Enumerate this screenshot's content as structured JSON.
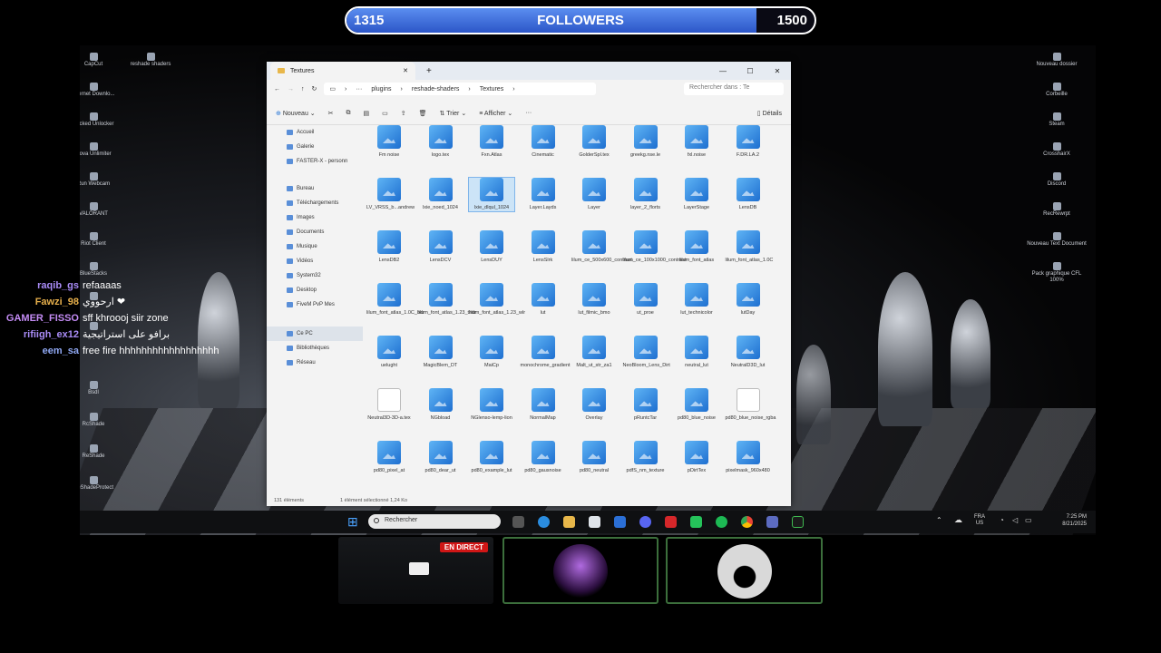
{
  "followers": {
    "current": "1315",
    "label": "FOLLOWERS",
    "goal": "1500",
    "progress": 0.8767
  },
  "desktop_icons": {
    "left": [
      "CapCut",
      "Internet Downlo...",
      "Clicked Unlocker",
      "Rova Unlimiter",
      "Run Webcam",
      "VALORANT",
      "Riot Client",
      "BlueStacks",
      "",
      ""
    ],
    "left_lower": [
      "Bsdl",
      "RcShade",
      "ReShade",
      "ReShadeProtect"
    ],
    "top": [
      "reshade shaders"
    ],
    "right": [
      "Nouveau dossier",
      "Corbeille",
      "Steam",
      "CrosshairX",
      "Discord",
      "RecRewrpt",
      "Nouveau Text Document",
      "Pack graphique CFL 100%"
    ]
  },
  "explorer": {
    "tab_title": "Textures",
    "breadcrumb": [
      "plugins",
      "reshade-shaders",
      "Textures"
    ],
    "search_placeholder": "Rechercher dans : Te",
    "toolbar": {
      "new": "Nouveau",
      "sort": "Trier",
      "view": "Afficher",
      "more": "···",
      "details": "Détails"
    },
    "nav": [
      "Accueil",
      "Galerie",
      "FASTER-X - personn",
      "Bureau",
      "Téléchargements",
      "Images",
      "Documents",
      "Musique",
      "Vidéos",
      "System32",
      "Desktop",
      "FiveM PvP Mes",
      "Ce PC",
      "Bibliothèques",
      "Réseau"
    ],
    "files": [
      "Fm noise",
      "logo.tex",
      "Fxn.Atlas",
      "Cinematic",
      "GolderSpl.tex",
      "greekg.nse.le",
      "fxl.noise",
      "F.DR.LA.2",
      "LV_VRSS_b...andrew",
      "lxie_noed_1024",
      "lxie_dlqul_1024",
      "Layer.Layds",
      "Layer",
      "layer_2_florts",
      "LayerStage",
      "LensDB",
      "LensDB2",
      "LensDCV",
      "LensDUY",
      "LensSlrk",
      "lilum_ce_500x600_contrast",
      "lilum_ce_100x1000_contrast",
      "lilum_font_atlas",
      "lilum_font_atlas_1.0C",
      "lilum_font_atlas_1.0C_bdr",
      "lilum_font_atlas_1.23_thdr",
      "lilum_font_atlas_1.23_wlr",
      "lut",
      "lut_filmic_bmo",
      "ut_proe",
      "lut_technicolor",
      "lutDay",
      "uelught",
      "MagicBlem_DT",
      "MaiCp",
      "monochrome_gradient",
      "Malt_ut_str_za1",
      "NeoBloom_Lens_Dirt",
      "neutral_lut",
      "NeutralD3D_lut",
      "Neutral3D-3D-a.tex",
      "NGbload",
      "NGlenso-lemp-lion",
      "NormalMap",
      "Overlay",
      "pRuntcTar",
      "pd80_blue_noise",
      "pd80_blue_noise_rgba",
      "pd80_pixel_at",
      "pd80_dear_ut",
      "pd80_example_lut",
      "pd80_gausnoise",
      "pd80_neutral",
      "pdfS_nm_texture",
      "pDirtTex",
      "pixelmask_960x480"
    ],
    "status_count": "131 éléments",
    "status_sel": "1 élément sélectionné  1,24 Ko"
  },
  "taskbar": {
    "search": "Rechercher",
    "lang_1": "FRA",
    "lang_2": "US",
    "time": "7:25 PM",
    "date": "8/21/2025"
  },
  "chat": [
    {
      "user": "raqib_gs",
      "color": "#a98cf7",
      "text": "refaaaas"
    },
    {
      "user": "Fawzi_98",
      "color": "#e7b04c",
      "text": "ارحووي ❤"
    },
    {
      "user": "GAMER_FISSO",
      "color": "#c48cf5",
      "text": "sff khroooj siir zone"
    },
    {
      "user": "rifiigh_ex12",
      "color": "#a98cf7",
      "text": "برافو على استراتيجية"
    },
    {
      "user": "eem_sa",
      "color": "#8fa7f2",
      "text": "free fire hhhhhhhhhhhhhhhhhh"
    }
  ],
  "live_badge": "EN DIRECT"
}
